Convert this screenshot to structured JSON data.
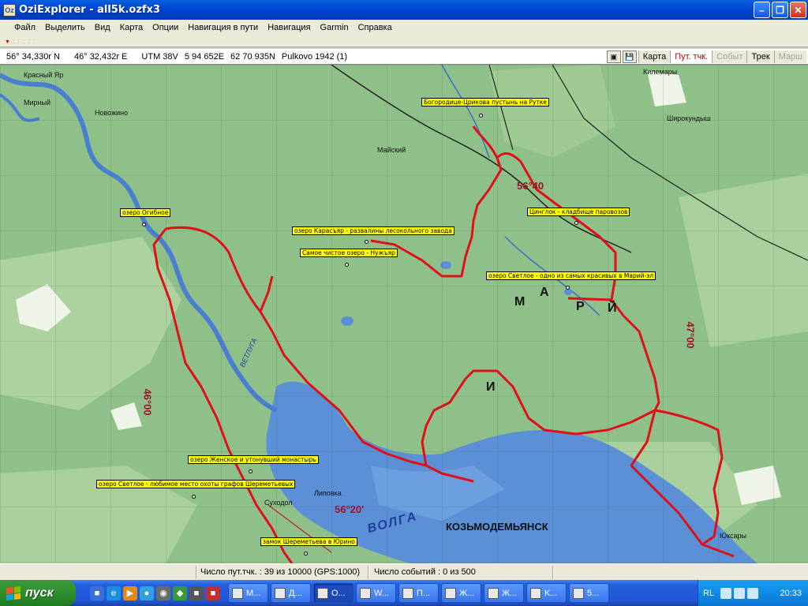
{
  "window": {
    "title": "OziExplorer - all5k.ozfx3"
  },
  "menu": [
    "Файл",
    "Выделить",
    "Вид",
    "Карта",
    "Опции",
    "Навигация в пути",
    "Навигация",
    "Garmin",
    "Справка"
  ],
  "info": {
    "lat": "56° 34,330r N",
    "lon": "46° 32,432r E",
    "utm": "UTM  38V",
    "easting": "5 94 652E",
    "northing": "62 70 935N",
    "datum": "Pulkovo 1942 (1)"
  },
  "toolbar_tabs": [
    {
      "label": "Карта",
      "state": "normal"
    },
    {
      "label": "Пут. тчк.",
      "state": "active"
    },
    {
      "label": "Событ",
      "state": "disabled"
    },
    {
      "label": "Трек",
      "state": "normal"
    },
    {
      "label": "Марш",
      "state": "disabled"
    }
  ],
  "waypoints": [
    {
      "label": "Богородице-Цриковa пустынь на Рутке"
    },
    {
      "label": "озеро Огибное"
    },
    {
      "label": "озеро Карасъяр - развалины лесокольного завода"
    },
    {
      "label": "Самое чистое озеро - Нужъяр"
    },
    {
      "label": "Цинглок - кладбище паровозов"
    },
    {
      "label": "озеро Светлое - одно из самых красивых в Марий-эл"
    },
    {
      "label": "озеро Женское и утонувший монастырь"
    },
    {
      "label": "озеро Светлое - любимое место охоты графов Шереметьевых"
    },
    {
      "label": "замок Шереметьева в Юрино"
    }
  ],
  "map_labels": {
    "krasny_yar": "Красный Яр",
    "mirny": "Мирный",
    "novozhino": "Новожино",
    "mayski": "Майский",
    "kilemary": "Килемары",
    "shirokundysh": "Широкундыш",
    "vetluga": "ВЕТЛУГА",
    "volga": "ВОЛГА",
    "kozmodemyansk": "КОЗЬМОДЕМЬЯНСК",
    "lipovka": "Липовка",
    "sukhodol": "Суходол",
    "yuksary": "Юксары",
    "mariy_m": "М",
    "mariy_a": "А",
    "mariy_r": "Р",
    "mariy_i": "И",
    "mariy_y": "Й",
    "grid_56_40": "56°40",
    "grid_56_20": "56°20'",
    "grid_47_00": "47°00",
    "grid_46_00": "46°00"
  },
  "status": {
    "waypoints_count": "Число пут.тчк. : 39 из 10000  (GPS:1000)",
    "events_count": "Число событий : 0 из 500"
  },
  "taskbar": {
    "start_label": "пуск",
    "tasks": [
      "M...",
      "Д...",
      "O...",
      "W...",
      "П...",
      "Ж...",
      "Ж...",
      "K...",
      "5..."
    ],
    "lang": "RL",
    "clock": "20:33"
  },
  "colors": {
    "track": "#e0101a",
    "water": "#5b8fd6",
    "forest": "#8fc08a",
    "label_bg": "#ffff00"
  }
}
